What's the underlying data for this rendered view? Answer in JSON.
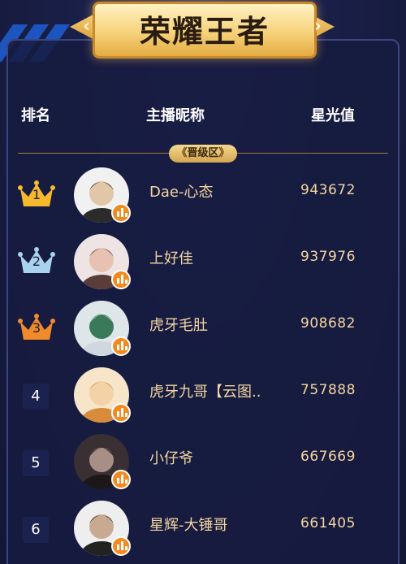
{
  "banner": {
    "title": "荣耀王者",
    "left_arrow": "‹",
    "right_arrow": "›"
  },
  "header": {
    "rank": "排名",
    "name": "主播昵称",
    "star": "星光值"
  },
  "zone": {
    "label": "晋级区",
    "left": "《",
    "right": "》"
  },
  "rows": [
    {
      "rank": "1",
      "name": "Dae-心态",
      "value": "943672",
      "crown": "gold",
      "avatar_colors": [
        "#f1f1f1",
        "#2b2b2b",
        "#e2c6a8"
      ]
    },
    {
      "rank": "2",
      "name": "上好佳",
      "value": "937976",
      "crown": "silver",
      "avatar_colors": [
        "#efe4e4",
        "#5a3d38",
        "#e7c2b2"
      ]
    },
    {
      "rank": "3",
      "name": "虎牙毛肚",
      "value": "908682",
      "crown": "bronze",
      "avatar_colors": [
        "#dfe6ea",
        "#cfd8de",
        "#3a7a5a"
      ]
    },
    {
      "rank": "4",
      "name": "虎牙九哥【云图..",
      "value": "757888",
      "crown": "",
      "avatar_colors": [
        "#f6e5c9",
        "#d98b3c",
        "#f4d2a8"
      ]
    },
    {
      "rank": "5",
      "name": "小仔爷",
      "value": "667669",
      "crown": "",
      "avatar_colors": [
        "#3a2f33",
        "#1c1719",
        "#a88f86"
      ]
    },
    {
      "rank": "6",
      "name": "星辉-大锤哥",
      "value": "661405",
      "crown": "",
      "avatar_colors": [
        "#eeeeee",
        "#222222",
        "#c9aa90"
      ]
    }
  ],
  "colors": {
    "gold": "#f5b92b",
    "silver": "#a9d2ee",
    "bronze": "#f08a2a",
    "badge": "#f28a1f",
    "value_text": "#f4d6a0"
  }
}
